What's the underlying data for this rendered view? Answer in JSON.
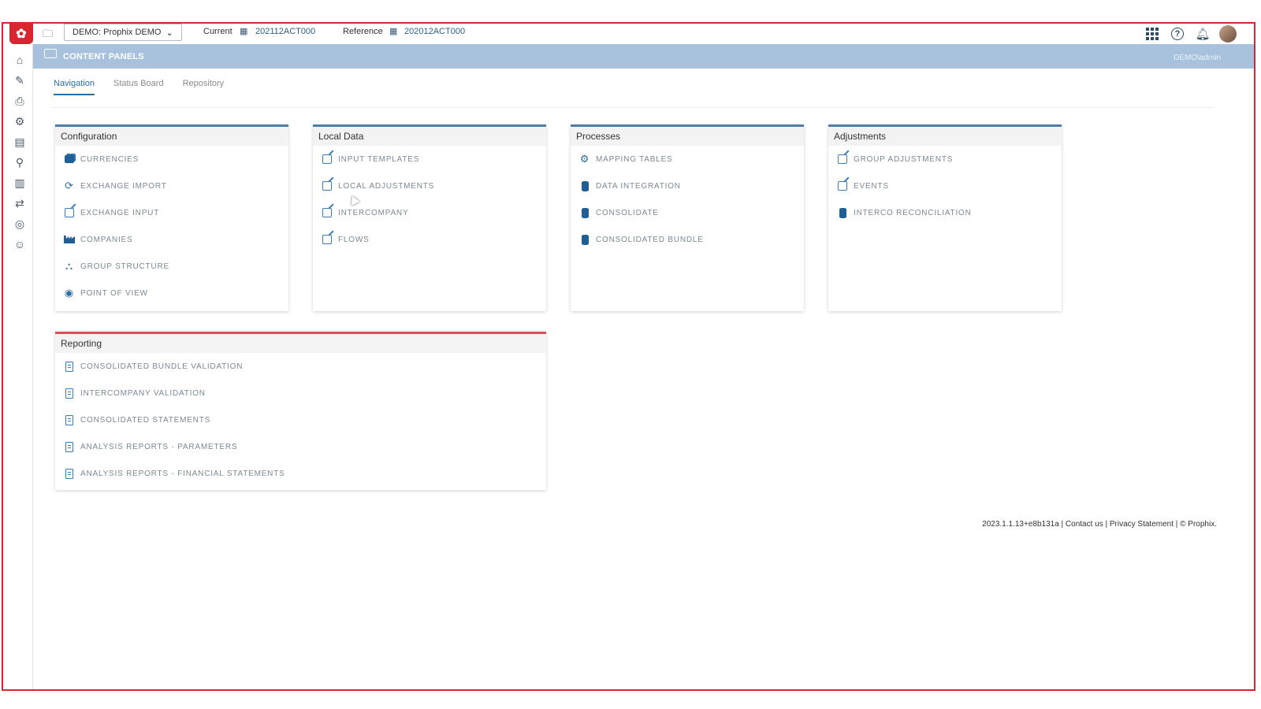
{
  "app": {
    "context_selector": "DEMO: Prophix DEMO",
    "current_label": "Current",
    "current_value": "202112ACT000",
    "reference_label": "Reference",
    "reference_value": "202012ACT000"
  },
  "banner": {
    "title": "CONTENT PANELS",
    "user": "DEMO\\admin"
  },
  "tabs": [
    {
      "label": "Navigation",
      "active": true
    },
    {
      "label": "Status Board",
      "active": false
    },
    {
      "label": "Repository",
      "active": false
    }
  ],
  "panels": {
    "configuration": {
      "title": "Configuration",
      "items": [
        "Currencies",
        "Exchange Import",
        "Exchange Input",
        "Companies",
        "Group Structure",
        "Point of View"
      ]
    },
    "local_data": {
      "title": "Local Data",
      "items": [
        "Input Templates",
        "Local Adjustments",
        "Intercompany",
        "Flows"
      ]
    },
    "processes": {
      "title": "Processes",
      "items": [
        "Mapping Tables",
        "Data Integration",
        "Consolidate",
        "Consolidated Bundle"
      ]
    },
    "adjustments": {
      "title": "Adjustments",
      "items": [
        "Group Adjustments",
        "Events",
        "Interco Reconciliation"
      ]
    },
    "reporting": {
      "title": "Reporting",
      "items": [
        "Consolidated Bundle Validation",
        "Intercompany Validation",
        "Consolidated Statements",
        "Analysis Reports - Parameters",
        "Analysis Reports - Financial Statements"
      ]
    }
  },
  "footer": "2023.1.1.13+e8b131a | Contact us | Privacy Statement | © Prophix.",
  "colors": {
    "accent": "#2b6ea3",
    "brand_red": "#d9252e",
    "banner": "#a8c2de"
  }
}
